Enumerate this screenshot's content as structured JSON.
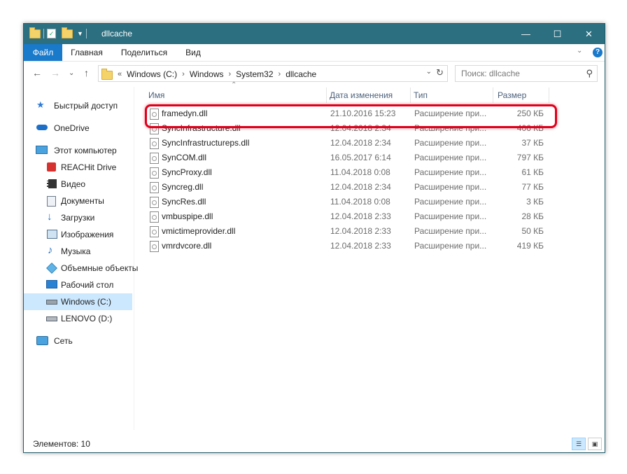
{
  "window": {
    "title": "dllcache",
    "minimize_glyph": "—",
    "maximize_glyph": "☐",
    "close_glyph": "✕"
  },
  "ribbon": {
    "tabs": [
      "Файл",
      "Главная",
      "Поделиться",
      "Вид"
    ],
    "accent": "#1979ca",
    "help_glyph": "?"
  },
  "nav": {
    "back_glyph": "←",
    "forward_glyph": "→",
    "up_glyph": "↑",
    "breadcrumb_prefix": "«",
    "breadcrumb": [
      "Windows (C:)",
      "Windows",
      "System32",
      "dllcache"
    ],
    "search_placeholder": "Поиск: dllcache"
  },
  "sidebar": {
    "items": [
      {
        "label": "Быстрый доступ",
        "icon": "star-icon"
      },
      {
        "label": "OneDrive",
        "icon": "cloud-icon"
      },
      {
        "label": "Этот компьютер",
        "icon": "computer-icon"
      },
      {
        "label": "REACHit Drive",
        "icon": "reachit-drive-icon"
      },
      {
        "label": "Видео",
        "icon": "video-icon"
      },
      {
        "label": "Документы",
        "icon": "documents-icon"
      },
      {
        "label": "Загрузки",
        "icon": "downloads-icon"
      },
      {
        "label": "Изображения",
        "icon": "pictures-icon"
      },
      {
        "label": "Музыка",
        "icon": "music-icon"
      },
      {
        "label": "Объемные объекты",
        "icon": "3d-objects-icon"
      },
      {
        "label": "Рабочий стол",
        "icon": "desktop-icon"
      },
      {
        "label": "Windows (C:)",
        "icon": "system-drive-icon",
        "selected": true
      },
      {
        "label": "LENOVO (D:)",
        "icon": "drive-icon"
      },
      {
        "label": "Сеть",
        "icon": "network-icon"
      }
    ]
  },
  "columns": {
    "name": "Имя",
    "date": "Дата изменения",
    "type": "Тип",
    "size": "Размер"
  },
  "files": [
    {
      "name": "framedyn.dll",
      "date": "21.10.2016 15:23",
      "type": "Расширение при...",
      "size": "250 КБ",
      "highlighted": true
    },
    {
      "name": "SyncInfrastructure.dll",
      "date": "12.04.2018 2:34",
      "type": "Расширение при...",
      "size": "406 КБ"
    },
    {
      "name": "SyncInfrastructureps.dll",
      "date": "12.04.2018 2:34",
      "type": "Расширение при...",
      "size": "37 КБ"
    },
    {
      "name": "SynCOM.dll",
      "date": "16.05.2017 6:14",
      "type": "Расширение при...",
      "size": "797 КБ"
    },
    {
      "name": "SyncProxy.dll",
      "date": "11.04.2018 0:08",
      "type": "Расширение при...",
      "size": "61 КБ"
    },
    {
      "name": "Syncreg.dll",
      "date": "12.04.2018 2:34",
      "type": "Расширение при...",
      "size": "77 КБ"
    },
    {
      "name": "SyncRes.dll",
      "date": "11.04.2018 0:08",
      "type": "Расширение при...",
      "size": "3 КБ"
    },
    {
      "name": "vmbuspipe.dll",
      "date": "12.04.2018 2:33",
      "type": "Расширение при...",
      "size": "28 КБ"
    },
    {
      "name": "vmictimeprovider.dll",
      "date": "12.04.2018 2:33",
      "type": "Расширение при...",
      "size": "50 КБ"
    },
    {
      "name": "vmrdvcore.dll",
      "date": "12.04.2018 2:33",
      "type": "Расширение при...",
      "size": "419 КБ"
    }
  ],
  "status": {
    "items_count": "Элементов: 10"
  },
  "colors": {
    "titlebar": "#2b6f80",
    "highlight_outline": "#e0001b",
    "selection": "#cce8ff"
  }
}
